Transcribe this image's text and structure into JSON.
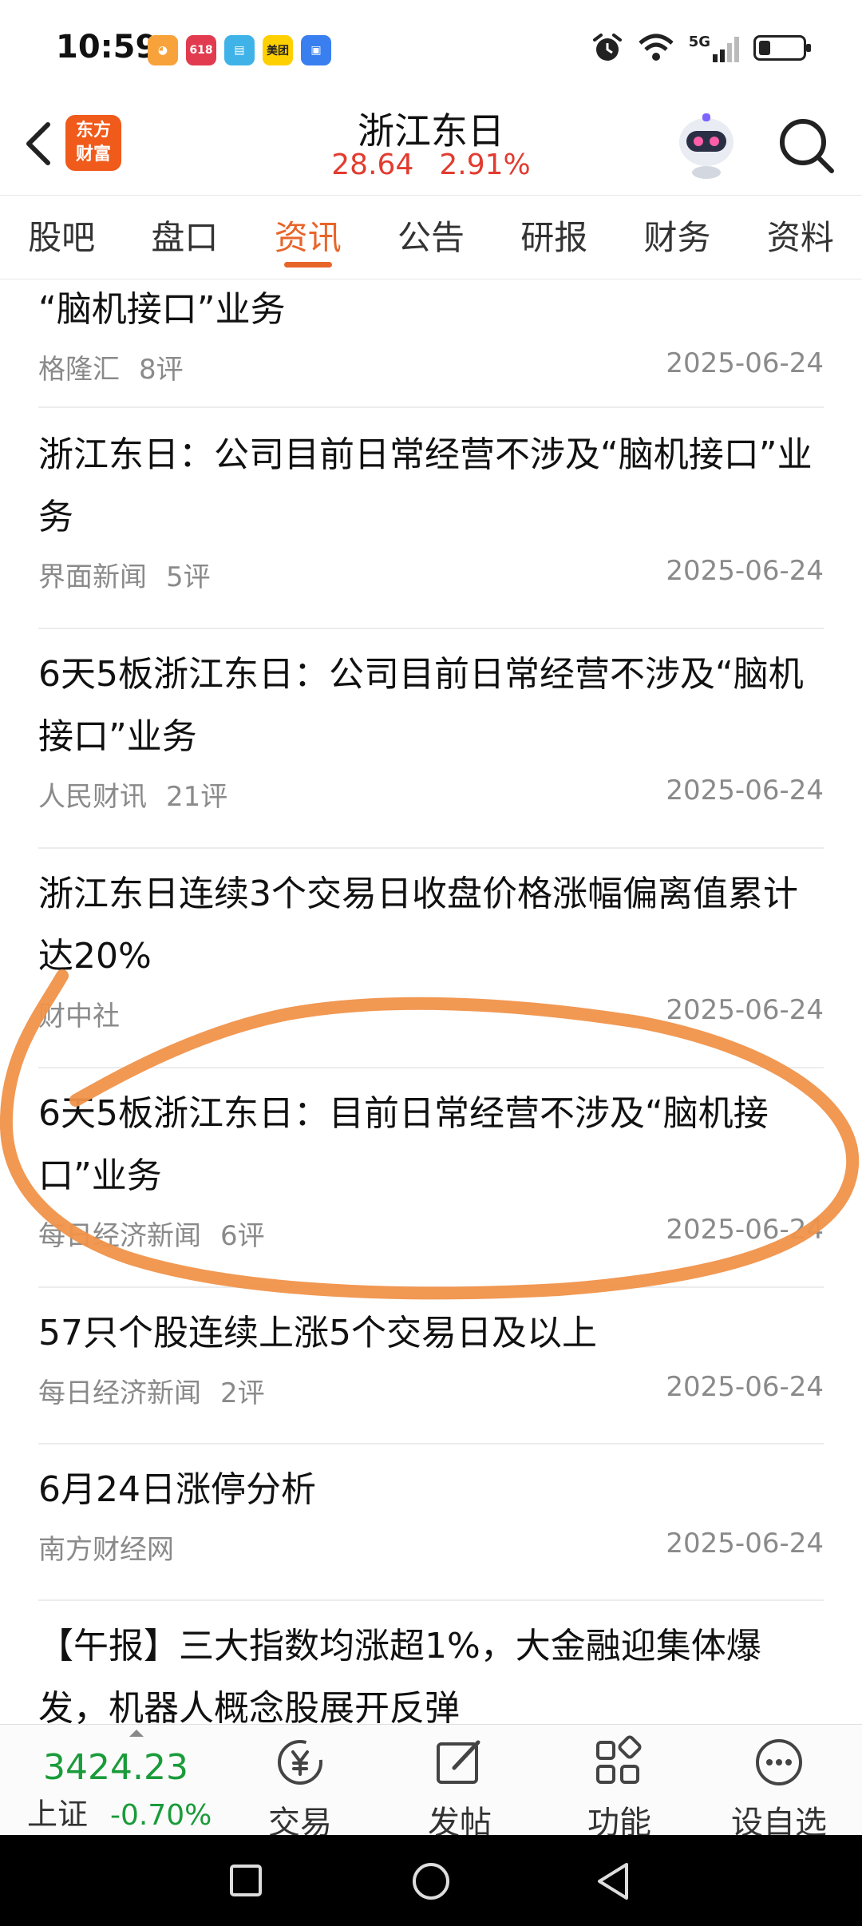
{
  "status_bar": {
    "time": "10:59",
    "app_icons": [
      {
        "name": "tmall-icon",
        "color": "#f7a23a"
      },
      {
        "name": "app-618-icon",
        "color": "#e23b4f",
        "text": "618"
      },
      {
        "name": "reader-icon",
        "color": "#3fb3e8"
      },
      {
        "name": "meituan-icon",
        "color": "#ffd000",
        "text": "美团"
      },
      {
        "name": "wallet-icon",
        "color": "#3a7ff0"
      }
    ],
    "network": "5G"
  },
  "header": {
    "logo_text": "东方财富",
    "stock_name": "浙江东日",
    "price": "28.64",
    "change_pct": "2.91%",
    "price_color": "#e23b2f"
  },
  "tabs": [
    {
      "label": "股吧",
      "active": false
    },
    {
      "label": "盘口",
      "active": false
    },
    {
      "label": "资讯",
      "active": true
    },
    {
      "label": "公告",
      "active": false
    },
    {
      "label": "研报",
      "active": false
    },
    {
      "label": "财务",
      "active": false
    },
    {
      "label": "资料",
      "active": false
    }
  ],
  "news": [
    {
      "title": "“脑机接口”业务",
      "source": "格隆汇",
      "comments": "8评",
      "date": "2025-06-24"
    },
    {
      "title": "浙江东日：公司目前日常经营不涉及“脑机接口”业务",
      "source": "界面新闻",
      "comments": "5评",
      "date": "2025-06-24"
    },
    {
      "title": "6天5板浙江东日：公司目前日常经营不涉及“脑机接口”业务",
      "source": "人民财讯",
      "comments": "21评",
      "date": "2025-06-24"
    },
    {
      "title": "浙江东日连续3个交易日收盘价格涨幅偏离值累计达20%",
      "source": "财中社",
      "comments": "",
      "date": "2025-06-24"
    },
    {
      "title": "6天5板浙江东日：目前日常经营不涉及“脑机接口”业务",
      "source": "每日经济新闻",
      "comments": "6评",
      "date": "2025-06-24"
    },
    {
      "title": "57只个股连续上涨5个交易日及以上",
      "source": "每日经济新闻",
      "comments": "2评",
      "date": "2025-06-24"
    },
    {
      "title": "6月24日涨停分析",
      "source": "南方财经网",
      "comments": "",
      "date": "2025-06-24"
    },
    {
      "title": "【午报】三大指数均涨超1%，大金融迎集体爆发，机器人概念股展开反弹",
      "source": "",
      "comments": "",
      "date": ""
    }
  ],
  "bottom_bar": {
    "index_value": "3424.23",
    "index_name": "上证",
    "index_change": "-0.70%",
    "index_color": "#1a9b3a",
    "buttons": [
      {
        "label": "交易",
        "icon": "yuan-refresh-icon"
      },
      {
        "label": "发帖",
        "icon": "edit-post-icon"
      },
      {
        "label": "功能",
        "icon": "grid-apps-icon"
      },
      {
        "label": "设自选",
        "icon": "more-dots-icon"
      }
    ]
  },
  "annotation": {
    "color": "#f0924a",
    "target": "news item 5"
  }
}
